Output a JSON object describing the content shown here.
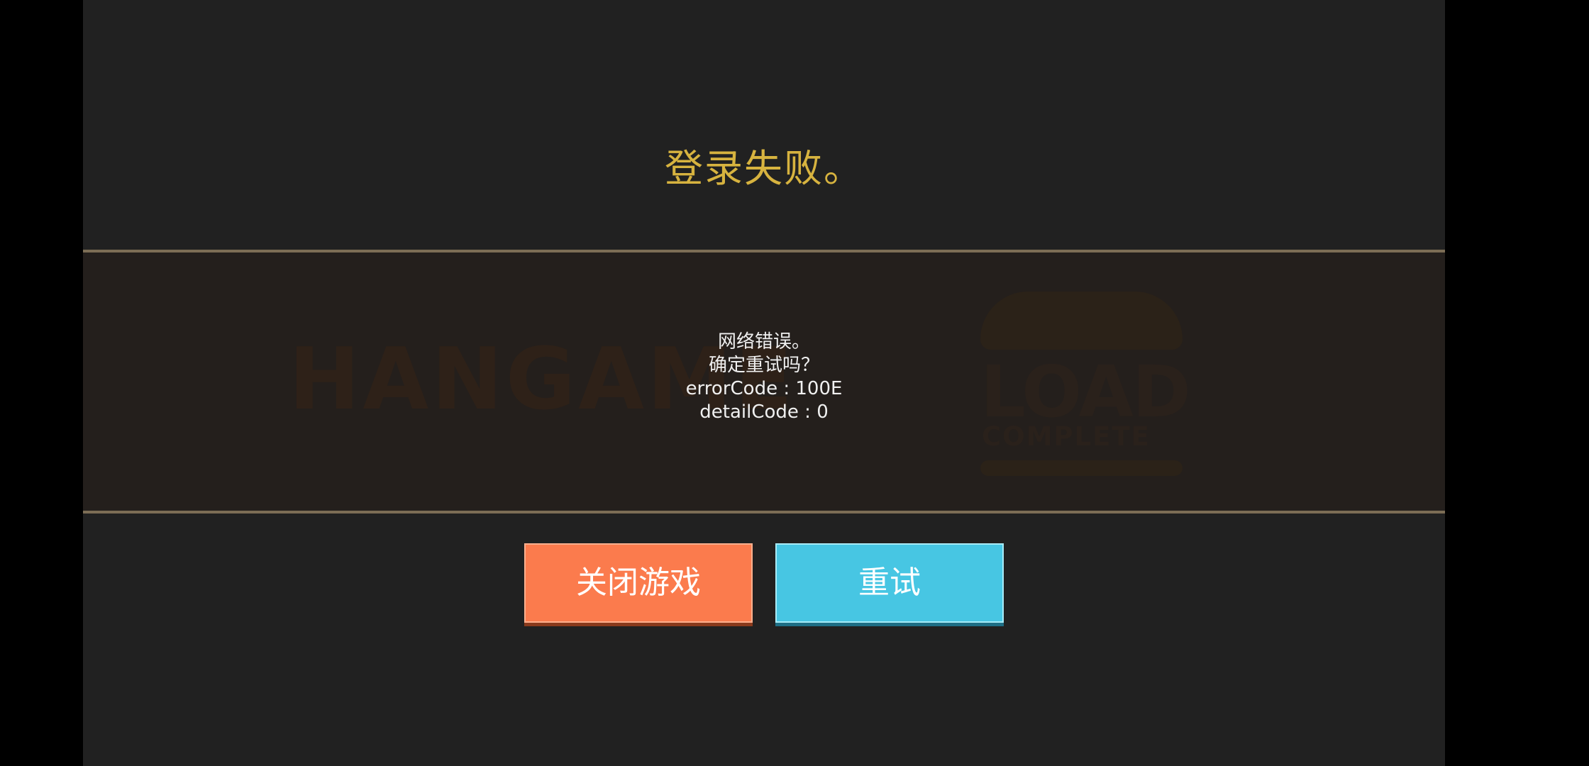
{
  "dialog": {
    "title": "登录失败。",
    "message_lines": [
      "网络错误。",
      "确定重试吗？",
      "errorCode : 100E",
      "detailCode : 0"
    ]
  },
  "background_logos": {
    "hangame": "HANGAME",
    "load": "LOAD",
    "complete": "COMPLETE"
  },
  "buttons": {
    "close_label": "关闭游戏",
    "retry_label": "重试"
  },
  "colors": {
    "title": "#d7b33f",
    "close_button": "#fb7b4d",
    "retry_button": "#47c6e3",
    "panel_bg": "#212121",
    "band_bg": "#241f1c"
  }
}
